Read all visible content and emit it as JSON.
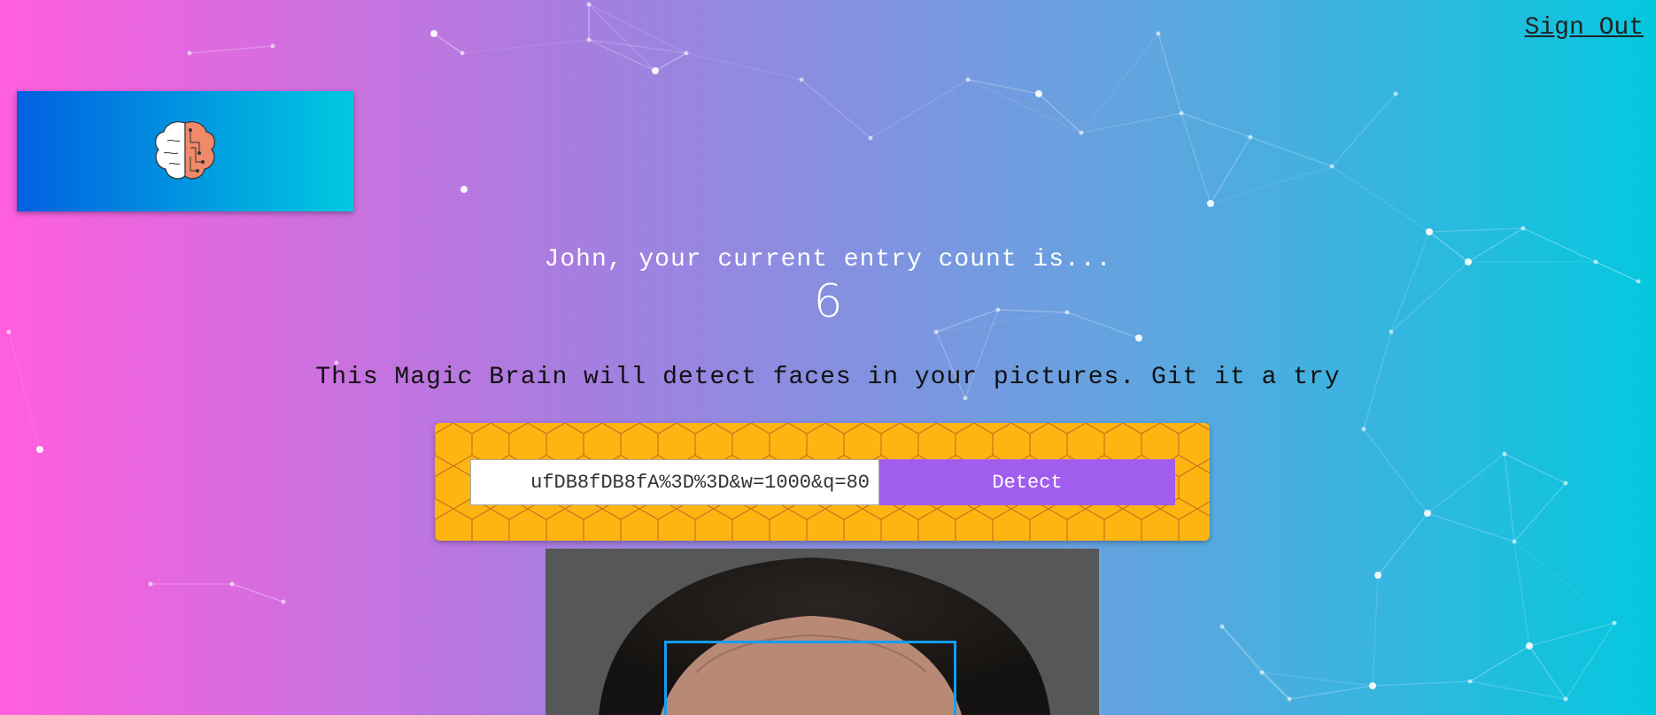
{
  "header": {
    "sign_out_label": "Sign Out"
  },
  "logo": {
    "icon": "brain-icon"
  },
  "rank": {
    "message": "John, your current entry count is...",
    "count": "6"
  },
  "tagline": "This Magic Brain will detect faces in your pictures. Git it a try",
  "form": {
    "url_value": "ufDB8fDB8fA%3D%3D&w=1000&q=80",
    "detect_label": "Detect"
  },
  "colors": {
    "accent_button": "#a15ded",
    "form_background": "#feb512",
    "face_box": "#149df2"
  }
}
